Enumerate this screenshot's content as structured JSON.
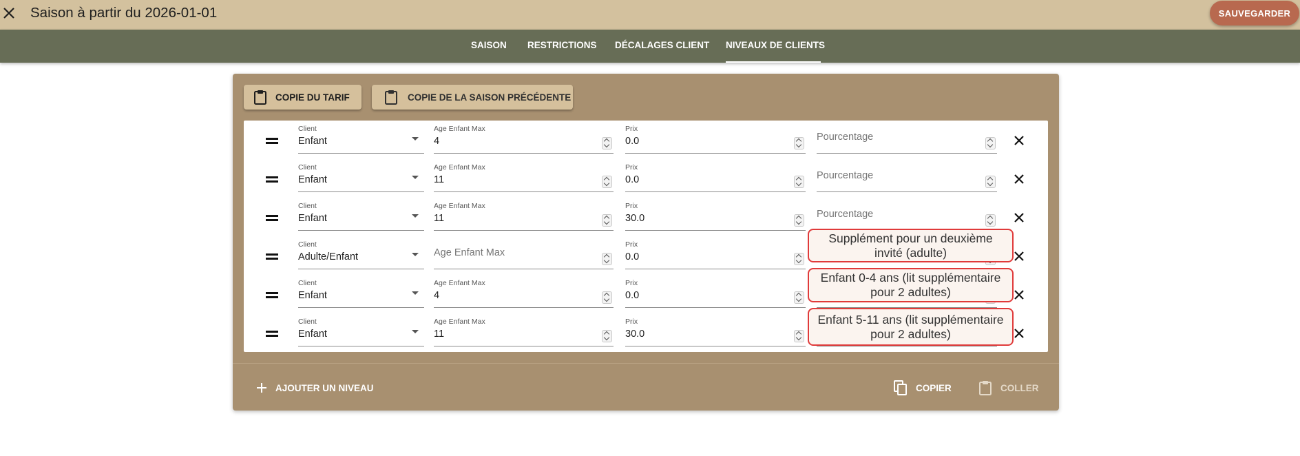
{
  "header": {
    "title": "Saison à partir du 2026-01-01",
    "save_label": "SAUVEGARDER"
  },
  "tabs": [
    {
      "label": "SAISON",
      "active": false
    },
    {
      "label": "RESTRICTIONS",
      "active": false
    },
    {
      "label": "DÉCALAGES CLIENT",
      "active": false
    },
    {
      "label": "NIVEAUX DE CLIENTS",
      "active": true
    }
  ],
  "toolbar": {
    "copy_tariff_label": "COPIE DU TARIF",
    "copy_previous_label": "COPIE DE LA SAISON PRÉCÉDENTE"
  },
  "field_labels": {
    "client": "Client",
    "age": "Age Enfant Max",
    "price": "Prix",
    "percent": "Pourcentage"
  },
  "levels": [
    {
      "client": "Enfant",
      "age": "4",
      "price": "0.0",
      "percent": "",
      "note": ""
    },
    {
      "client": "Enfant",
      "age": "11",
      "price": "0.0",
      "percent": "",
      "note": ""
    },
    {
      "client": "Enfant",
      "age": "11",
      "price": "30.0",
      "percent": "",
      "note": ""
    },
    {
      "client": "Adulte/Enfant",
      "age": "",
      "price": "0.0",
      "percent": "",
      "note": "Supplément pour un deuxième invité (adulte)"
    },
    {
      "client": "Enfant",
      "age": "4",
      "price": "0.0",
      "percent": "",
      "note": "Enfant 0-4 ans (lit supplémentaire pour 2 adultes)"
    },
    {
      "client": "Enfant",
      "age": "11",
      "price": "30.0",
      "percent": "",
      "note": "Enfant 5-11 ans (lit supplémentaire pour 2 adultes)"
    }
  ],
  "footer": {
    "add_level_label": "AJOUTER UN NIVEAU",
    "copy_label": "COPIER",
    "paste_label": "COLLER"
  },
  "colors": {
    "header_bg": "#d3c19e",
    "nav_bg": "#676d56",
    "card_bg": "#a89070",
    "save_bg": "#b8694f",
    "note_border": "#e03a3a"
  }
}
